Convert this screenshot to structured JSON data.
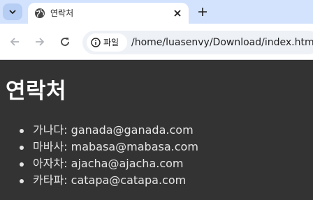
{
  "browser": {
    "tab": {
      "title": "연락처"
    },
    "address": {
      "scheme_chip": "파일",
      "url": "/home/luasenvy/Download/index.html"
    },
    "colors": {
      "tabstrip": "#d3e3fd",
      "page_bg": "#333333"
    }
  },
  "page": {
    "heading": "연락처",
    "contacts": [
      {
        "name": "가나다",
        "separator": ": ",
        "email": "ganada@ganada.com"
      },
      {
        "name": "마바사",
        "separator": ": ",
        "email": "mabasa@mabasa.com"
      },
      {
        "name": "아자차",
        "separator": ": ",
        "email": "ajacha@ajacha.com"
      },
      {
        "name": "카타파",
        "separator": ": ",
        "email": "catapa@catapa.com"
      }
    ]
  }
}
